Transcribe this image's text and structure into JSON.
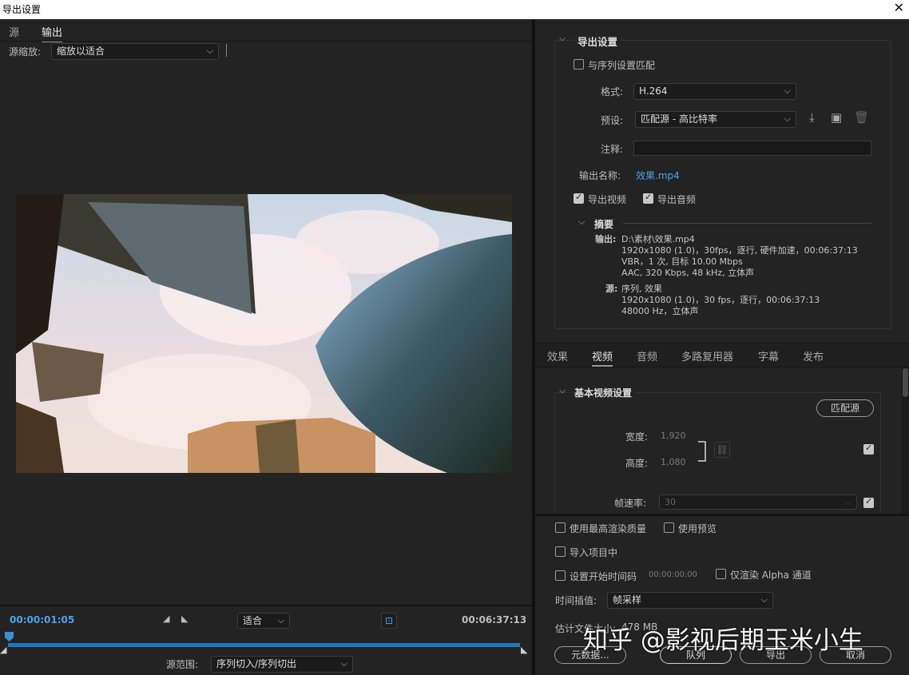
{
  "window": {
    "title": "导出设置",
    "close_glyph": "✕"
  },
  "left": {
    "tabs": [
      {
        "label": "源"
      },
      {
        "label": "输出"
      }
    ],
    "source_scale": {
      "label": "源缩放:",
      "value": "缩放以适合"
    },
    "timecode_current": "00:00:01:05",
    "timecode_end": "00:06:37:13",
    "fit": {
      "value": "适合"
    },
    "source_range": {
      "label": "源范围:",
      "value": "序列切入/序列切出"
    },
    "timeline_progress": 0.003
  },
  "export": {
    "section_title": "导出设置",
    "match_sequence": {
      "label": "与序列设置匹配",
      "checked": false
    },
    "format": {
      "label": "格式:",
      "value": "H.264"
    },
    "preset": {
      "label": "预设:",
      "value": "匹配源 - 高比特率"
    },
    "comments": {
      "label": "注释:",
      "value": ""
    },
    "output_name": {
      "label": "输出名称:",
      "value": "效果.mp4"
    },
    "export_video": {
      "label": "导出视频",
      "checked": true
    },
    "export_audio": {
      "label": "导出音频",
      "checked": true
    },
    "summary": {
      "title": "摘要",
      "output_label": "输出:",
      "output_lines": [
        "D:\\素材\\效果.mp4",
        "1920x1080 (1.0)，30fps，逐行, 硬件加速，00:06:37:13",
        "VBR，1 次, 目标 10.00 Mbps",
        "AAC, 320 Kbps, 48 kHz, 立体声"
      ],
      "source_label": "源:",
      "source_lines": [
        "序列, 效果",
        "1920x1080 (1.0)，30 fps，逐行，00:06:37:13",
        "48000 Hz，立体声"
      ]
    }
  },
  "tabs2": [
    {
      "label": "效果"
    },
    {
      "label": "视频"
    },
    {
      "label": "音频"
    },
    {
      "label": "多路复用器"
    },
    {
      "label": "字幕"
    },
    {
      "label": "发布"
    }
  ],
  "video": {
    "section_title": "基本视频设置",
    "match_source": "匹配源",
    "width": {
      "label": "宽度:",
      "value": "1,920"
    },
    "height": {
      "label": "高度:",
      "value": "1,080"
    },
    "frame_rate": {
      "label": "帧速率:",
      "value": "30"
    }
  },
  "bottom": {
    "max_render": {
      "label": "使用最高渲染质量",
      "checked": false
    },
    "use_previews": {
      "label": "使用预览",
      "checked": false
    },
    "import_project": {
      "label": "导入项目中",
      "checked": false
    },
    "set_start_tc": {
      "label": "设置开始时间码",
      "value": "00:00:00:00",
      "checked": false
    },
    "alpha_only": {
      "label": "仅渲染 Alpha 通道",
      "checked": false
    },
    "time_interp": {
      "label": "时间插值:",
      "value": "帧采样"
    },
    "est_file_size": {
      "label": "估计文件大小:",
      "value": "478 MB"
    },
    "buttons": {
      "metadata": "元数据...",
      "queue": "队列",
      "export": "导出",
      "cancel": "取消"
    }
  },
  "watermark": "知乎 @影视后期玉米小生",
  "colors": {
    "accent": "#4aa3f0",
    "panel": "#232323"
  }
}
